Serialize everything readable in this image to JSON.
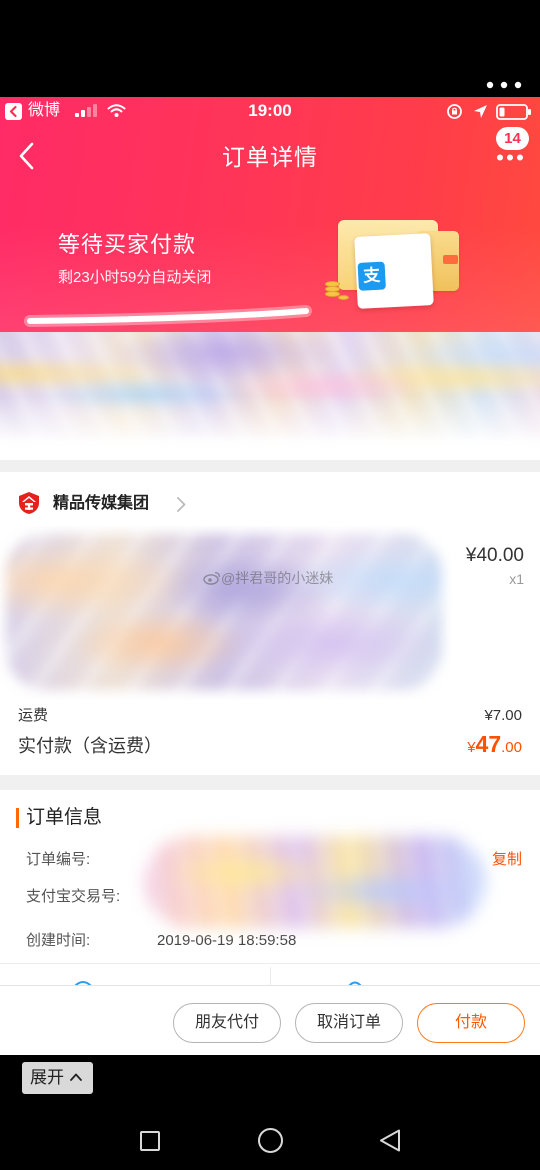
{
  "status_bar": {
    "back_app_label": "微博",
    "time": "19:00",
    "signal_bars": 2,
    "signal_bars_total": 4,
    "battery_fraction": 0.2
  },
  "nav": {
    "title": "订单详情",
    "message_badge": "14"
  },
  "banner": {
    "status": "等待买家付款",
    "countdown": "剩23小时59分自动关闭",
    "alipay_logo_glyph": "支"
  },
  "shop": {
    "name": "精品传媒集团"
  },
  "item": {
    "price": "¥40.00",
    "quantity": "x1"
  },
  "watermark": {
    "text": "@拌君哥的小迷妹"
  },
  "summary": {
    "shipping_label": "运费",
    "shipping_value": "¥7.00",
    "total_label": "实付款（含运费）",
    "total_currency": "¥",
    "total_integer": "47",
    "total_decimal": ".00"
  },
  "order_info": {
    "title": "订单信息",
    "order_no_label": "订单编号:",
    "copy_label": "复制",
    "alipay_trade_no_label": "支付宝交易号:",
    "created_label": "创建时间:",
    "created_value": "2019-06-19 18:59:58"
  },
  "actions": {
    "friend_pay": "朋友代付",
    "cancel_order": "取消订单",
    "pay": "付款"
  },
  "overlay": {
    "expand_label": "展开"
  },
  "colors": {
    "header_left": "#ff2b66",
    "header_right": "#ff4a3e",
    "accent_orange": "#ff5000",
    "pay_border": "#ff7a1a",
    "alipay_blue": "#1a9af0",
    "page_gap": "#f0f0f0"
  },
  "icons": {
    "overflow": "overflow-menu-icon",
    "back_app": "back-to-app-icon",
    "signal": "signal-icon",
    "wifi": "wifi-icon",
    "rotation_lock": "rotation-lock-icon",
    "location": "location-arrow-icon",
    "battery": "battery-icon",
    "back": "back-chevron-icon",
    "more": "more-dots-icon",
    "shop": "shop-logo-icon",
    "shop_chevron": "chevron-right-icon",
    "weibo": "weibo-logo-icon",
    "expand": "chevron-up-icon",
    "android_recents": "recents-square-icon",
    "android_home": "home-circle-icon",
    "android_back": "back-triangle-icon"
  }
}
